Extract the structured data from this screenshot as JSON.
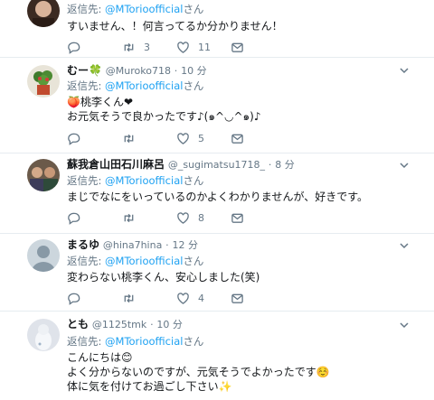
{
  "reply_prefix": "返信先: ",
  "reply_suffix": "さん",
  "reply_target": "@MTorioofficial",
  "tweets": [
    {
      "name": "",
      "handle": "",
      "time": "",
      "lines": [
        "すいません、！何言ってるか分かりません！"
      ],
      "replies": "",
      "retweets": "3",
      "likes": "11"
    },
    {
      "name": "むー🍀",
      "handle": "@Muroko718",
      "time": "10 分",
      "lines": [
        "🍑桃李くん❤",
        "お元気そうで良かったです♪(๑^◡^๑)♪"
      ],
      "replies": "",
      "retweets": "",
      "likes": "5"
    },
    {
      "name": "蘇我倉山田石川麻呂",
      "handle": "@_sugimatsu1718_",
      "time": "8 分",
      "lines": [
        "まじでなにをいっているのかよくわかりませんが、好きです。"
      ],
      "replies": "",
      "retweets": "",
      "likes": "8"
    },
    {
      "name": "まるゆ",
      "handle": "@hina7hina",
      "time": "12 分",
      "lines": [
        "変わらない桃李くん、安心しました(笑)"
      ],
      "replies": "",
      "retweets": "",
      "likes": "4"
    },
    {
      "name": "とも",
      "handle": "@1125tmk",
      "time": "10 分",
      "lines": [
        "こんにちは😊",
        "よく分からないのですが、元気そうでよかったです☺️",
        "体に気を付けてお過ごし下さい✨"
      ],
      "replies": "",
      "retweets": "",
      "likes": ""
    }
  ],
  "colors": {
    "accent": "#1da1f2",
    "muted": "#657786",
    "text": "#14171a",
    "border": "#e6ecf0"
  },
  "icons": [
    "reply-icon",
    "retweet-icon",
    "like-icon",
    "dm-icon",
    "caret-down-icon"
  ]
}
